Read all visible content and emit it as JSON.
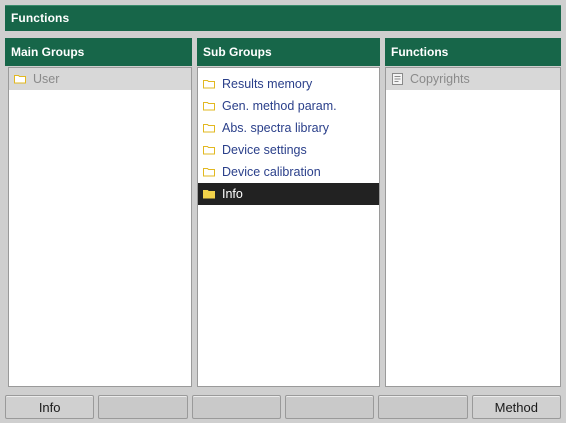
{
  "window": {
    "title": "Functions"
  },
  "columns": {
    "main_groups": {
      "header": "Main Groups",
      "items": [
        {
          "label": "User",
          "icon": "folder-icon",
          "state": "highlighted"
        }
      ]
    },
    "sub_groups": {
      "header": "Sub Groups",
      "items": [
        {
          "label": "Results memory",
          "icon": "folder-icon"
        },
        {
          "label": "Gen. method param.",
          "icon": "folder-icon"
        },
        {
          "label": "Abs. spectra library",
          "icon": "folder-icon"
        },
        {
          "label": "Device settings",
          "icon": "folder-icon"
        },
        {
          "label": "Device calibration",
          "icon": "folder-icon"
        },
        {
          "label": "Info",
          "icon": "folder-open-icon",
          "state": "selected"
        }
      ]
    },
    "functions": {
      "header": "Functions",
      "items": [
        {
          "label": "Copyrights",
          "icon": "document-icon",
          "state": "highlighted"
        }
      ]
    }
  },
  "softkeys": [
    {
      "label": "Info"
    },
    {
      "label": ""
    },
    {
      "label": ""
    },
    {
      "label": ""
    },
    {
      "label": ""
    },
    {
      "label": "Method"
    }
  ],
  "colors": {
    "header_green": "#176649",
    "text_blue": "#2a3f8a",
    "selected_bg": "#222222",
    "folder_yellow": "#e8c64a"
  }
}
